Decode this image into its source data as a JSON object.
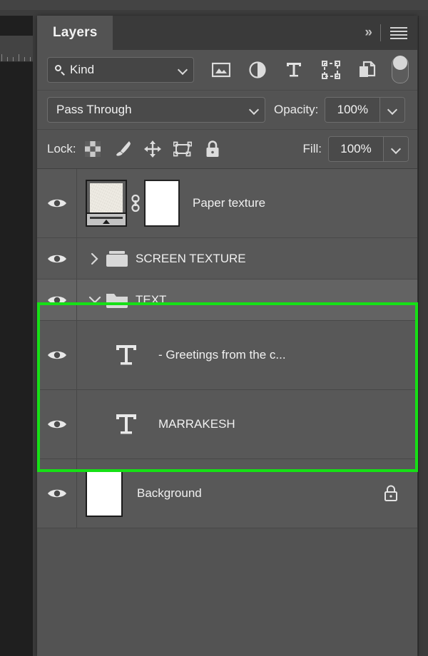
{
  "app": {
    "panel_title": "Layers"
  },
  "tabbar": {
    "collapse_label": "»",
    "menu_icon": "hamburger-menu-icon"
  },
  "filter_row": {
    "kind_label": "Kind",
    "search_icon": "search-icon",
    "icons": [
      {
        "name": "pixel-layers-filter-icon",
        "title": "Filter for pixel layers"
      },
      {
        "name": "adjustment-layers-filter-icon",
        "title": "Filter for adjustment layers"
      },
      {
        "name": "type-layers-filter-icon",
        "title": "Filter for type layers"
      },
      {
        "name": "shape-layers-filter-icon",
        "title": "Filter for shape layers"
      },
      {
        "name": "smart-object-filter-icon",
        "title": "Filter for smart objects"
      }
    ],
    "toggle_state": "on"
  },
  "blend_row": {
    "blend_mode": "Pass Through",
    "opacity_label": "Opacity:",
    "opacity_value": "100%"
  },
  "lock_row": {
    "lock_label": "Lock:",
    "fill_label": "Fill:",
    "fill_value": "100%",
    "icons": [
      {
        "name": "lock-transparent-pixels-icon"
      },
      {
        "name": "lock-image-pixels-icon"
      },
      {
        "name": "lock-position-icon"
      },
      {
        "name": "lock-artboard-nesting-icon"
      },
      {
        "name": "lock-all-icon"
      }
    ]
  },
  "layers": [
    {
      "name": "Paper texture",
      "type": "smart-object",
      "visible": true,
      "selected": false,
      "has_mask": true,
      "linked": true,
      "locked": false
    },
    {
      "name": "SCREEN TEXTURE",
      "type": "group",
      "visible": true,
      "selected": false,
      "expanded": false,
      "locked": false
    },
    {
      "name": "TEXT",
      "type": "group",
      "visible": true,
      "selected": true,
      "expanded": true,
      "locked": false
    },
    {
      "name": "- Greetings from the c...",
      "type": "text",
      "visible": true,
      "selected": false,
      "locked": false
    },
    {
      "name": "MARRAKESH",
      "type": "text",
      "visible": true,
      "selected": false,
      "locked": false
    },
    {
      "name": "Background",
      "type": "image",
      "visible": true,
      "selected": false,
      "locked": true
    }
  ],
  "annotation": {
    "highlight_color": "#16e016",
    "highlight_label": "text-group-selection-highlight"
  },
  "colors": {
    "panel_bg": "#535353",
    "row_bg": "#585858",
    "row_selected_bg": "#636363",
    "tabbar_bg": "#3a3a3a",
    "text": "#f0f0f0"
  }
}
